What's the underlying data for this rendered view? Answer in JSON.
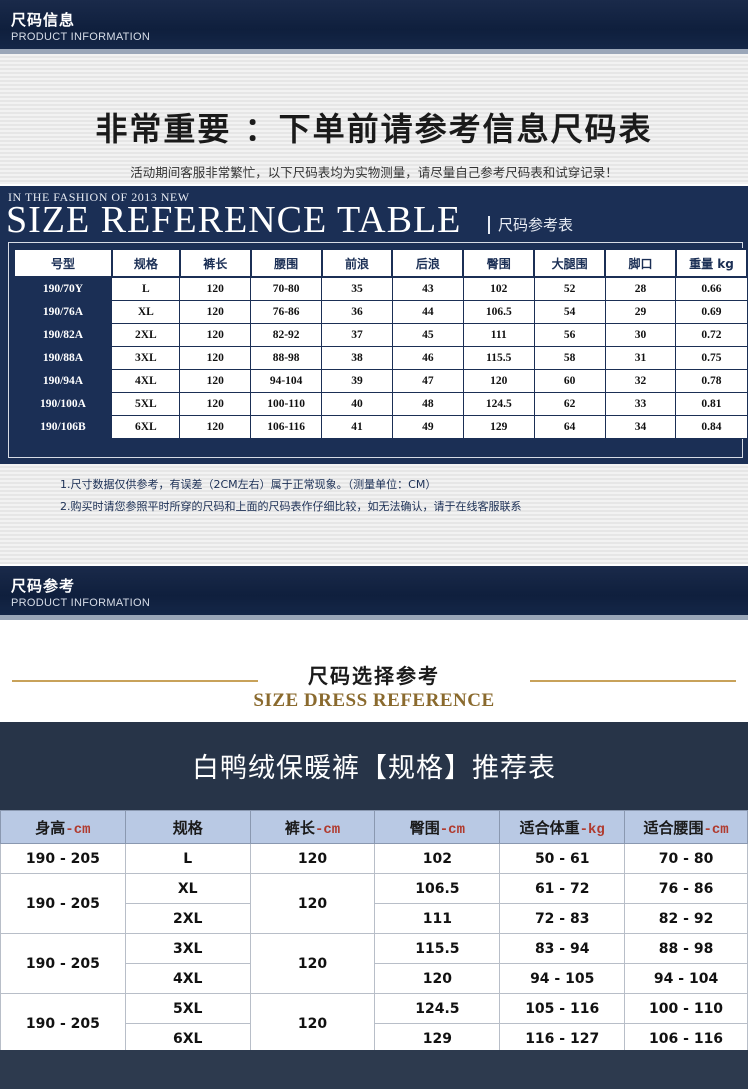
{
  "section1": {
    "title": "尺码信息",
    "subtitle": "PRODUCT INFORMATION"
  },
  "headline": "非常重要 ：下单前请参考信息尺码表",
  "subnote": "活动期间客服非常繁忙，以下尺码表均为实物测量，请尽量自己参考尺码表和试穿记录！",
  "size_table": {
    "tagline": "IN THE FASHION OF 2013 NEW",
    "title": "SIZE REFERENCE TABLE",
    "title_cn": "尺码参考表",
    "headers": [
      "号型",
      "规格",
      "裤长",
      "腰围",
      "前浪",
      "后浪",
      "臀围",
      "大腿围",
      "脚口",
      "重量 kg"
    ],
    "rows": [
      [
        "190/70Y",
        "L",
        "120",
        "70-80",
        "35",
        "43",
        "102",
        "52",
        "28",
        "0.66"
      ],
      [
        "190/76A",
        "XL",
        "120",
        "76-86",
        "36",
        "44",
        "106.5",
        "54",
        "29",
        "0.69"
      ],
      [
        "190/82A",
        "2XL",
        "120",
        "82-92",
        "37",
        "45",
        "111",
        "56",
        "30",
        "0.72"
      ],
      [
        "190/88A",
        "3XL",
        "120",
        "88-98",
        "38",
        "46",
        "115.5",
        "58",
        "31",
        "0.75"
      ],
      [
        "190/94A",
        "4XL",
        "120",
        "94-104",
        "39",
        "47",
        "120",
        "60",
        "32",
        "0.78"
      ],
      [
        "190/100A",
        "5XL",
        "120",
        "100-110",
        "40",
        "48",
        "124.5",
        "62",
        "33",
        "0.81"
      ],
      [
        "190/106B",
        "6XL",
        "120",
        "106-116",
        "41",
        "49",
        "129",
        "64",
        "34",
        "0.84"
      ]
    ]
  },
  "notes": [
    "1.尺寸数据仅供参考，有误差（2CM左右）属于正常现象。（测量单位：CM）",
    "2.购买时请您参照平时所穿的尺码和上面的尺码表作仔细比较，如无法确认，请于在线客服联系"
  ],
  "section2": {
    "title": "尺码参考",
    "subtitle": "PRODUCT INFORMATION"
  },
  "dress_ref": {
    "title": "尺码选择参考",
    "subtitle": "SIZE DRESS REFERENCE"
  },
  "banner": "白鸭绒保暖裤【规格】推荐表",
  "recommend_table": {
    "headers": [
      {
        "label": "身高",
        "unit": "-cm"
      },
      {
        "label": "规格",
        "unit": ""
      },
      {
        "label": "裤长",
        "unit": "-cm"
      },
      {
        "label": "臀围",
        "unit": "-cm"
      },
      {
        "label": "适合体重",
        "unit": "-kg"
      },
      {
        "label": "适合腰围",
        "unit": "-cm"
      }
    ],
    "groups": [
      {
        "height": "190 - 205",
        "length": "120",
        "rows": [
          {
            "size": "L",
            "hip": "102",
            "weight": "50 - 61",
            "waist": "70 - 80"
          }
        ]
      },
      {
        "height": "190 - 205",
        "length": "120",
        "rows": [
          {
            "size": "XL",
            "hip": "106.5",
            "weight": "61 - 72",
            "waist": "76 - 86"
          },
          {
            "size": "2XL",
            "hip": "111",
            "weight": "72 - 83",
            "waist": "82 - 92"
          }
        ]
      },
      {
        "height": "190 - 205",
        "length": "120",
        "rows": [
          {
            "size": "3XL",
            "hip": "115.5",
            "weight": "83 - 94",
            "waist": "88 - 98"
          },
          {
            "size": "4XL",
            "hip": "120",
            "weight": "94 - 105",
            "waist": "94 - 104"
          }
        ]
      },
      {
        "height": "190 - 205",
        "length": "120",
        "rows": [
          {
            "size": "5XL",
            "hip": "124.5",
            "weight": "105 - 116",
            "waist": "100 - 110"
          },
          {
            "size": "6XL",
            "hip": "129",
            "weight": "116 - 127",
            "waist": "106 - 116"
          }
        ]
      }
    ]
  }
}
